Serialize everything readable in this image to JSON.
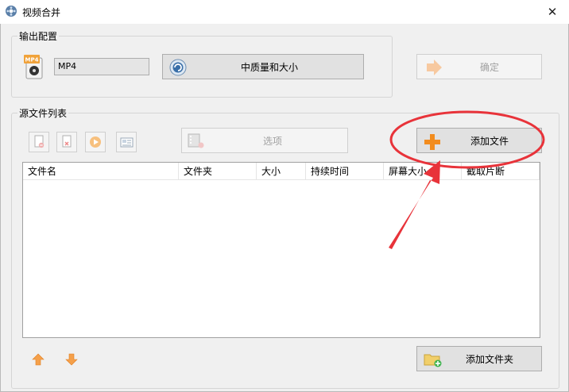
{
  "window": {
    "title": "视频合并",
    "close_glyph": "✕"
  },
  "output_group": {
    "label": "输出配置",
    "format_badge": "MP4",
    "format_value": "MP4",
    "quality_label": "中质量和大小",
    "confirm_label": "确定"
  },
  "source_group": {
    "label": "源文件列表",
    "options_label": "选项",
    "add_file_label": "添加文件",
    "add_folder_label": "添加文件夹",
    "columns": [
      "文件名",
      "文件夹",
      "大小",
      "持续时间",
      "屏幕大小",
      "截取片断"
    ]
  },
  "icons": {
    "app": "video-merge-icon",
    "format": "mp4-file-icon",
    "quality": "quality-gear-icon",
    "confirm": "confirm-arrow-icon",
    "remove": "remove-file-icon",
    "clear": "clear-list-icon",
    "play": "play-icon",
    "info": "info-card-icon",
    "options": "film-options-icon",
    "add_file": "plus-icon",
    "add_folder": "folder-add-icon",
    "move_up": "arrow-up-icon",
    "move_down": "arrow-down-icon"
  },
  "colors": {
    "annotation": "#e8333a",
    "add_plus": "#f28c1e",
    "arrow_orange": "#f5a04a"
  }
}
